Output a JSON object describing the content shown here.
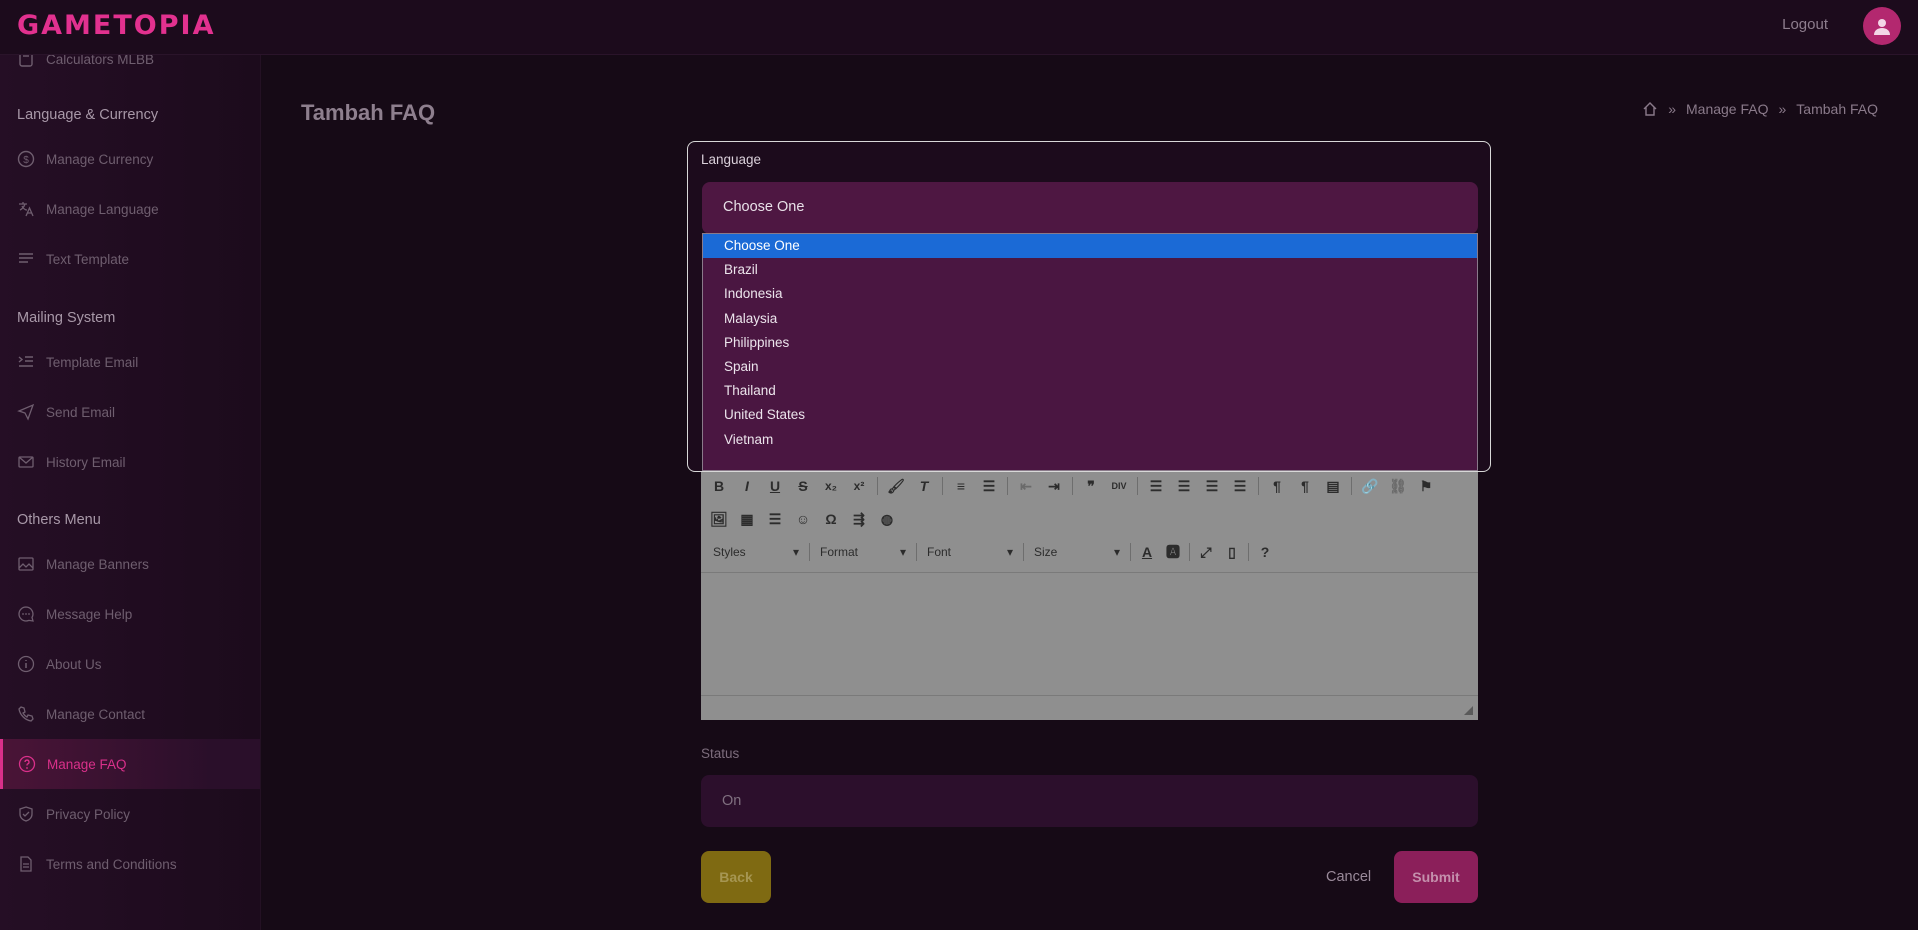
{
  "brand": {
    "logo": "GAMETOPIA",
    "accent": "#e2318f"
  },
  "header": {
    "logout_label": "Logout",
    "avatar_icon": "user-icon"
  },
  "sidebar": {
    "partial_item": "Calculators MLBB",
    "sections": [
      {
        "title": "Language & Currency",
        "items": [
          "Manage Currency",
          "Manage Language",
          "Text Template"
        ]
      },
      {
        "title": "Mailing System",
        "items": [
          "Template Email",
          "Send Email",
          "History Email"
        ]
      },
      {
        "title": "Others Menu",
        "items": [
          "Manage Banners",
          "Message Help",
          "About Us",
          "Manage Contact",
          "Manage FAQ",
          "Privacy Policy",
          "Terms and Conditions"
        ]
      }
    ],
    "active_item": "Manage FAQ"
  },
  "page": {
    "title": "Tambah FAQ",
    "breadcrumb": [
      "Manage FAQ",
      "Tambah FAQ"
    ]
  },
  "language_field": {
    "label": "Language",
    "value": "Choose One",
    "options": [
      "Choose One",
      "Brazil",
      "Indonesia",
      "Malaysia",
      "Philippines",
      "Spain",
      "Thailand",
      "United States",
      "Vietnam"
    ],
    "highlighted": "Choose One"
  },
  "editor": {
    "styles_label": "Styles",
    "format_label": "Format",
    "font_label": "Font",
    "size_label": "Size"
  },
  "status_field": {
    "label": "Status",
    "value": "On"
  },
  "actions": {
    "back": "Back",
    "cancel": "Cancel",
    "submit": "Submit"
  }
}
